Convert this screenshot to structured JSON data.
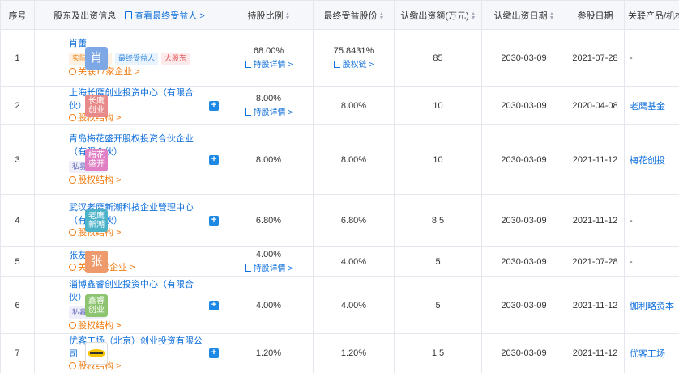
{
  "headers": {
    "index": "序号",
    "shareholder": "股东及出资信息",
    "view_beneficiary": "查看最终受益人 >",
    "ratio": "持股比例",
    "final_ratio": "最终受益股份",
    "subscribed": "认缴出资额(万元)",
    "subscribe_date": "认缴出资日期",
    "join_date": "参股日期",
    "related": "关联产品/机构"
  },
  "rows": [
    {
      "index": "1",
      "logo_text": "肖",
      "logo_color": "#7ea7e6",
      "big": true,
      "name": "肖蕾",
      "tags": [
        {
          "text": "实际控制人",
          "cls": "orange"
        },
        {
          "text": "最终受益人",
          "cls": "blue"
        },
        {
          "text": "大股东",
          "cls": "red"
        }
      ],
      "sub_link": "关联17家企业 >",
      "plus": false,
      "ratio": "68.00%",
      "ratio_link": "持股详情 >",
      "final_ratio": "75.8431%",
      "final_link": "股权链 >",
      "subscribed": "85",
      "subscribe_date": "2030-03-09",
      "join_date": "2021-07-28",
      "related": "-",
      "related_link": false
    },
    {
      "index": "2",
      "logo_text": "长鹰创业",
      "logo_color": "#e98a8a",
      "big": false,
      "name": "上海长鹰创业投资中心（有限合伙）",
      "tags": [],
      "sub_link": "股权结构 >",
      "plus": true,
      "ratio": "8.00%",
      "ratio_link": "持股详情 >",
      "final_ratio": "8.00%",
      "final_link": "",
      "subscribed": "10",
      "subscribe_date": "2030-03-09",
      "join_date": "2020-04-08",
      "related": "老鹰基金",
      "related_link": true
    },
    {
      "index": "3",
      "logo_text": "梅花盛开",
      "logo_color": "#e07fc3",
      "big": false,
      "name": "青岛梅花盛开股权投资合伙企业（有限合伙）",
      "tags": [
        {
          "text": "私募基金",
          "cls": "purple"
        }
      ],
      "sub_link": "股权结构 >",
      "plus": true,
      "ratio": "8.00%",
      "ratio_link": "",
      "final_ratio": "8.00%",
      "final_link": "",
      "subscribed": "10",
      "subscribe_date": "2030-03-09",
      "join_date": "2021-11-12",
      "related": "梅花创投",
      "related_link": true
    },
    {
      "index": "4",
      "logo_text": "老鹰新潮",
      "logo_color": "#4db3c9",
      "big": false,
      "name": "武汉老鹰新潮科技企业管理中心（有限合伙）",
      "tags": [],
      "sub_link": "股权结构 >",
      "plus": true,
      "ratio": "6.80%",
      "ratio_link": "",
      "final_ratio": "6.80%",
      "final_link": "",
      "subscribed": "8.5",
      "subscribe_date": "2030-03-09",
      "join_date": "2021-11-12",
      "related": "-",
      "related_link": false
    },
    {
      "index": "5",
      "logo_text": "张",
      "logo_color": "#ee9a6c",
      "big": true,
      "name": "张友灿",
      "tags": [],
      "sub_link": "关联2家企业 >",
      "plus": false,
      "ratio": "4.00%",
      "ratio_link": "持股详情 >",
      "final_ratio": "4.00%",
      "final_link": "",
      "subscribed": "5",
      "subscribe_date": "2030-03-09",
      "join_date": "2021-07-28",
      "related": "-",
      "related_link": false
    },
    {
      "index": "6",
      "logo_text": "鑫睿创业",
      "logo_color": "#8cc46f",
      "big": false,
      "name": "淄博鑫睿创业投资中心（有限合伙）",
      "tags": [
        {
          "text": "私募基金",
          "cls": "purple"
        }
      ],
      "sub_link": "股权结构 >",
      "plus": true,
      "ratio": "4.00%",
      "ratio_link": "",
      "final_ratio": "4.00%",
      "final_link": "",
      "subscribed": "5",
      "subscribe_date": "2030-03-09",
      "join_date": "2021-11-12",
      "related": "伽利略资本",
      "related_link": true
    },
    {
      "index": "7",
      "logo_text": "",
      "logo_color": "#ffffff",
      "big": false,
      "image_logo": true,
      "name": "优客工场（北京）创业投资有限公司",
      "tags": [],
      "sub_link": "股权结构 >",
      "plus": true,
      "ratio": "1.20%",
      "ratio_link": "",
      "final_ratio": "1.20%",
      "final_link": "",
      "subscribed": "1.5",
      "subscribe_date": "2030-03-09",
      "join_date": "2021-11-12",
      "related": "优客工场",
      "related_link": true
    }
  ]
}
